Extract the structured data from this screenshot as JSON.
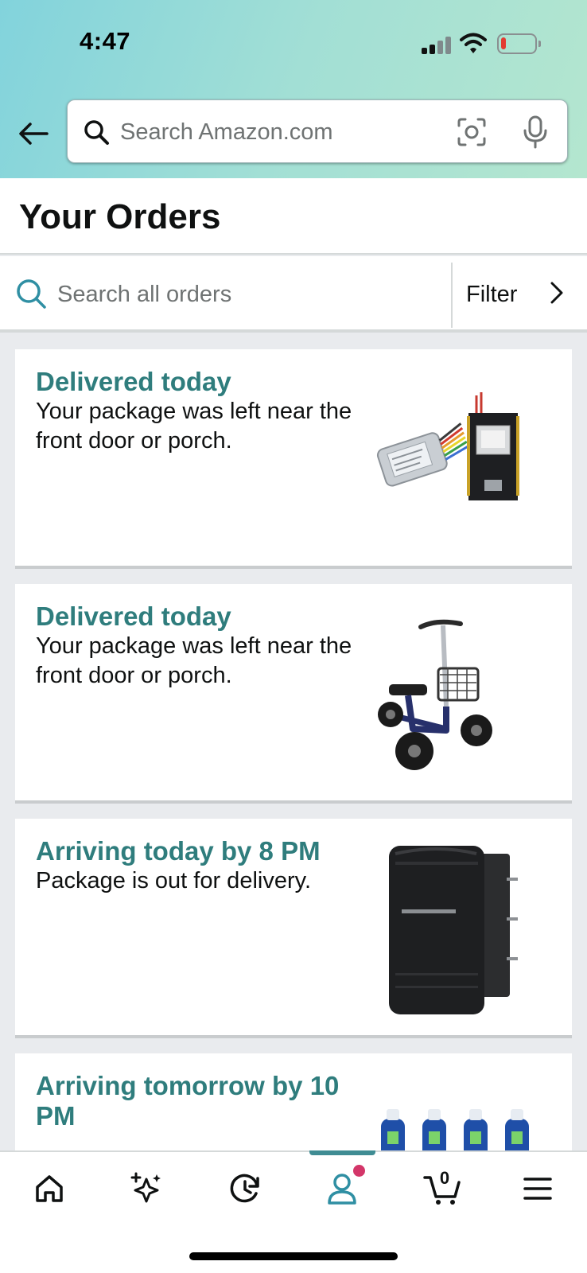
{
  "status_bar": {
    "time": "4:47"
  },
  "header": {
    "search_placeholder": "Search Amazon.com"
  },
  "page": {
    "title": "Your Orders"
  },
  "order_search": {
    "placeholder": "Search all orders",
    "filter_label": "Filter"
  },
  "orders": [
    {
      "status": "Delivered today",
      "detail": "Your package was left near the front door or porch.",
      "image": "relay-module-and-esp32-board"
    },
    {
      "status": "Delivered today",
      "detail": "Your package was left near the front door or porch.",
      "image": "knee-scooter-with-basket"
    },
    {
      "status": "Arriving today by 8 PM",
      "detail": "Package is out for delivery.",
      "image": "rocker-switch"
    },
    {
      "status": "Arriving tomorrow by 10 PM",
      "detail": "",
      "image": "bottles-blue-caps"
    }
  ],
  "bottom_nav": {
    "items": [
      "home-icon",
      "sparkle-icon",
      "history-icon",
      "account-icon",
      "cart-icon",
      "menu-icon"
    ],
    "cart_count": "0",
    "active": "account-icon"
  },
  "colors": {
    "accent": "#2f7d7d",
    "nav_indicator": "#3f8c93",
    "notification": "#d33669"
  }
}
